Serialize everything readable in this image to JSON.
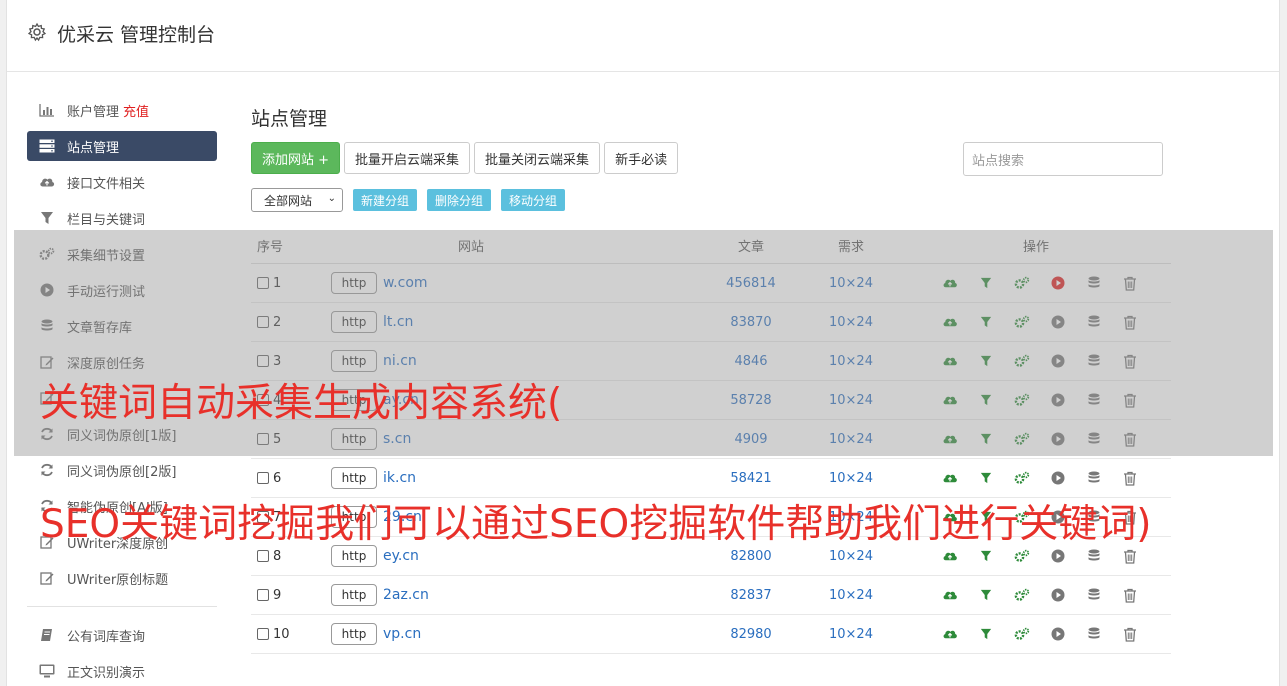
{
  "app": {
    "title": "优采云 管理控制台"
  },
  "sidebar": {
    "items": [
      {
        "label": "账户管理",
        "extra": "充值",
        "icon": "bar-chart-icon",
        "active": false
      },
      {
        "label": "站点管理",
        "icon": "server-icon",
        "active": true
      },
      {
        "label": "接口文件相关",
        "icon": "cloud-upload-icon",
        "active": false
      },
      {
        "label": "栏目与关键词",
        "icon": "filter-icon",
        "active": false
      },
      {
        "label": "采集细节设置",
        "icon": "cogs-icon",
        "active": false
      },
      {
        "label": "手动运行测试",
        "icon": "play-circle-icon",
        "active": false
      },
      {
        "label": "文章暂存库",
        "icon": "database-icon",
        "active": false
      },
      {
        "label": "深度原创任务",
        "icon": "edit-icon",
        "active": false
      },
      {
        "label": "",
        "icon": "edit-icon",
        "active": false
      },
      {
        "label": "同义词伪原创[1版]",
        "icon": "refresh-icon",
        "active": false
      },
      {
        "label": "同义词伪原创[2版]",
        "icon": "refresh-icon",
        "active": false
      },
      {
        "label": "智能伪原创[AI版]",
        "icon": "refresh-icon",
        "active": false
      },
      {
        "label": "UWriter深度原创",
        "icon": "edit-icon",
        "active": false
      },
      {
        "label": "UWriter原创标题",
        "icon": "edit-icon",
        "active": false
      }
    ],
    "items2": [
      {
        "label": "公有词库查询",
        "icon": "book-icon"
      },
      {
        "label": "正文识别演示",
        "icon": "monitor-icon"
      }
    ]
  },
  "main": {
    "title": "站点管理",
    "buttons": {
      "add": "添加网站 +",
      "enable": "批量开启云端采集",
      "disable": "批量关闭云端采集",
      "guide": "新手必读"
    },
    "search_placeholder": "站点搜索",
    "group_select": "全部网站",
    "group_buttons": {
      "new": "新建分组",
      "delete": "删除分组",
      "move": "移动分组"
    }
  },
  "table": {
    "headers": {
      "no": "序号",
      "site": "网站",
      "articles": "文章",
      "demand": "需求",
      "ops": "操作"
    },
    "rows": [
      {
        "no": "1",
        "protocol": "http",
        "site": "w.com",
        "articles": "456814",
        "demand": "10×24",
        "running": true
      },
      {
        "no": "2",
        "protocol": "http",
        "site": "lt.cn",
        "articles": "83870",
        "demand": "10×24",
        "running": false
      },
      {
        "no": "3",
        "protocol": "http",
        "site": "ni.cn",
        "articles": "4846",
        "demand": "10×24",
        "running": false
      },
      {
        "no": "4",
        "protocol": "http",
        "site": "ay.cn",
        "articles": "58728",
        "demand": "10×24",
        "running": false
      },
      {
        "no": "5",
        "protocol": "http",
        "site": "s.cn",
        "articles": "4909",
        "demand": "10×24",
        "running": false
      },
      {
        "no": "6",
        "protocol": "http",
        "site": "ik.cn",
        "articles": "58421",
        "demand": "10×24",
        "running": false
      },
      {
        "no": "7",
        "protocol": "http",
        "site": "29.cn",
        "articles": "",
        "demand": "10×24",
        "running": false
      },
      {
        "no": "8",
        "protocol": "http",
        "site": "ey.cn",
        "articles": "82800",
        "demand": "10×24",
        "running": false
      },
      {
        "no": "9",
        "protocol": "http",
        "site": "2az.cn",
        "articles": "82837",
        "demand": "10×24",
        "running": false
      },
      {
        "no": "10",
        "protocol": "http",
        "site": "vp.cn",
        "articles": "82980",
        "demand": "10×24",
        "running": false
      }
    ]
  },
  "watermark": {
    "line1": "关键词自动采集生成内容系统(",
    "line2": "SEO关键词挖掘我们可以通过SEO挖掘软件帮助我们进行关键词)"
  },
  "colors": {
    "accent_green": "#5cb85c",
    "sidebar_active": "#3a4a66",
    "link_blue": "#2a6ebf",
    "info_blue": "#5bc0de",
    "watermark_red": "#e8302a",
    "run_red": "#e02020"
  }
}
